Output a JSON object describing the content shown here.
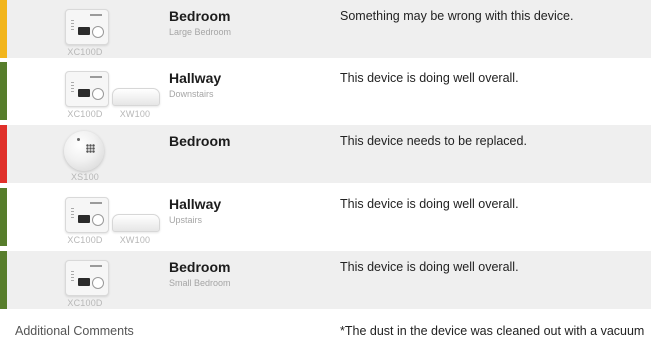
{
  "colors": {
    "warning": "#f2b51c",
    "good": "#577d2b",
    "critical": "#e0302a",
    "row_shaded": "#efefef"
  },
  "devices": [
    {
      "room": "Bedroom",
      "location": "Large Bedroom",
      "status": "Something may be wrong with this device.",
      "status_level": "warning",
      "images": [
        {
          "model": "XC100D",
          "icon": "co-detector-icon"
        }
      ]
    },
    {
      "room": "Hallway",
      "location": "Downstairs",
      "status": "This device is doing well overall.",
      "status_level": "good",
      "images": [
        {
          "model": "XC100D",
          "icon": "co-detector-icon"
        },
        {
          "model": "XW100",
          "icon": "wireless-sensor-icon"
        }
      ]
    },
    {
      "room": "Bedroom",
      "location": "",
      "status": "This device needs to be replaced.",
      "status_level": "critical",
      "images": [
        {
          "model": "XS100",
          "icon": "smoke-detector-icon"
        }
      ]
    },
    {
      "room": "Hallway",
      "location": "Upstairs",
      "status": "This device is doing well overall.",
      "status_level": "good",
      "images": [
        {
          "model": "XC100D",
          "icon": "co-detector-icon"
        },
        {
          "model": "XW100",
          "icon": "wireless-sensor-icon"
        }
      ]
    },
    {
      "room": "Bedroom",
      "location": "Small Bedroom",
      "status": "This device is doing well overall.",
      "status_level": "good",
      "images": [
        {
          "model": "XC100D",
          "icon": "co-detector-icon"
        }
      ]
    }
  ],
  "comments": {
    "label": "Additional Comments",
    "text": "*The dust in the device was cleaned out with a vacuum"
  }
}
